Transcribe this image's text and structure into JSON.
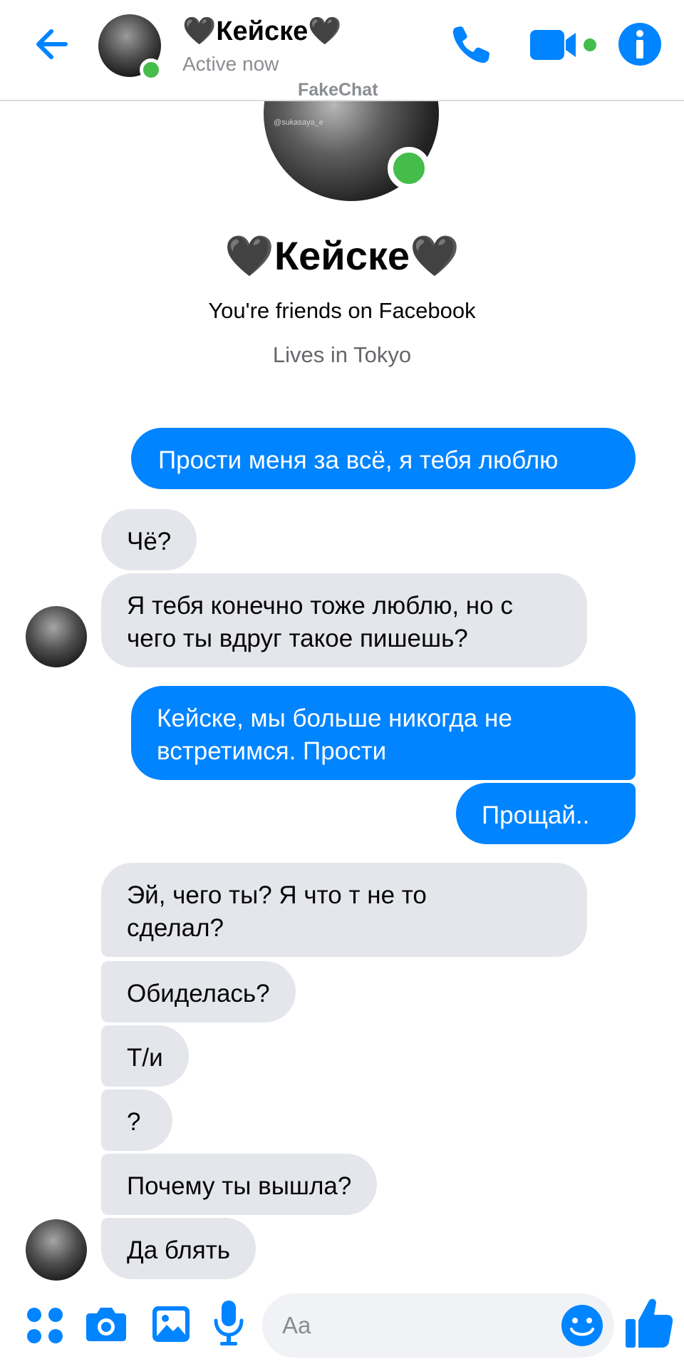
{
  "header": {
    "contact_name": "🖤Кейске🖤",
    "status": "Active now",
    "watermark": "FakeChat",
    "icons": [
      "back-arrow-icon",
      "phone-icon",
      "video-camera-icon",
      "info-icon"
    ]
  },
  "profile": {
    "name": "🖤Кейске🖤",
    "friends_text": "You're friends on Facebook",
    "lives_text": "Lives in Tokyo",
    "avatar_credit": "@sukasaya_e"
  },
  "messages": [
    {
      "direction": "out",
      "text": "Прости меня за всё, я тебя люблю"
    },
    {
      "direction": "in",
      "text": "Чё?"
    },
    {
      "direction": "in",
      "text": "Я тебя конечно тоже люблю, но с\nчего ты вдруг такое пишешь?"
    },
    {
      "direction": "out",
      "text": "Кейске, мы больше никогда не\nвстретимся. Прости"
    },
    {
      "direction": "out",
      "text": "Прощай.."
    },
    {
      "direction": "in",
      "text": "Эй, чего ты? Я что т не то\nсделал?"
    },
    {
      "direction": "in",
      "text": "Обиделась?"
    },
    {
      "direction": "in",
      "text": "Т/и"
    },
    {
      "direction": "in",
      "text": "?"
    },
    {
      "direction": "in",
      "text": "Почему ты вышла?"
    },
    {
      "direction": "in",
      "text": "Да блять"
    }
  ],
  "composer": {
    "placeholder": "Aa",
    "icons": [
      "apps-icon",
      "camera-icon",
      "gallery-icon",
      "microphone-icon",
      "emoji-icon",
      "thumbs-up-icon"
    ]
  },
  "colors": {
    "accent": "#0084ff",
    "incoming_bubble": "#e4e6eb",
    "online": "#45bd4a"
  }
}
